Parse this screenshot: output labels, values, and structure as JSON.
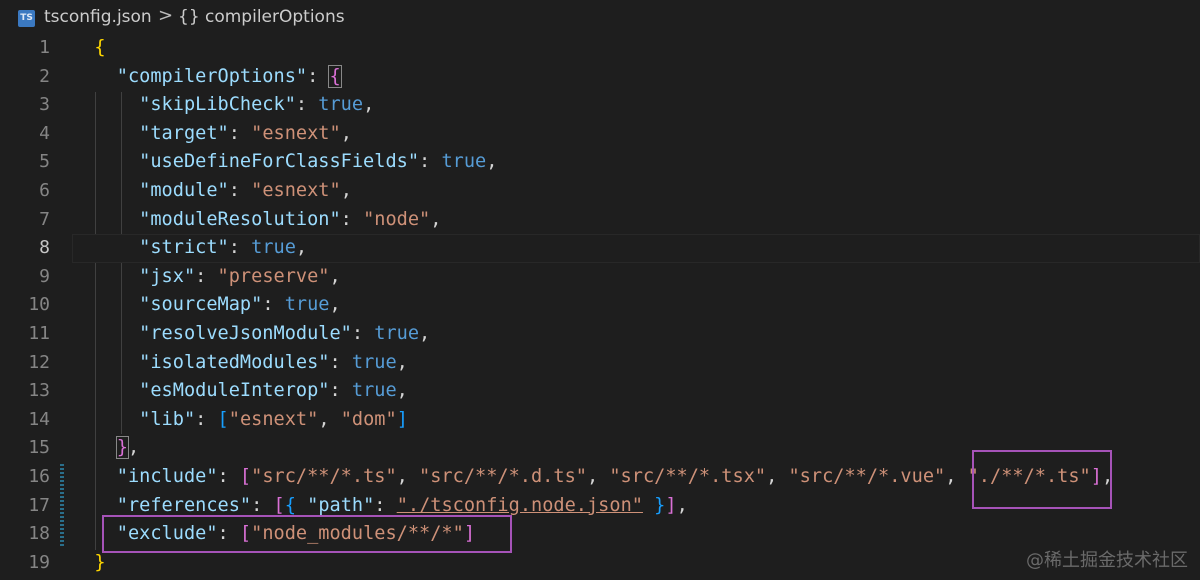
{
  "breadcrumb": {
    "file_icon": "TS",
    "file_name": "tsconfig.json",
    "separator": ">",
    "symbol_braces": "{}",
    "symbol_name": "compilerOptions"
  },
  "editor": {
    "line_numbers": [
      "1",
      "2",
      "3",
      "4",
      "5",
      "6",
      "7",
      "8",
      "9",
      "10",
      "11",
      "12",
      "13",
      "14",
      "15",
      "16",
      "17",
      "18",
      "19"
    ],
    "active_line": "8"
  },
  "watermark": "@稀土掘金技术社区",
  "colors": {
    "background": "#1e1e1e",
    "key": "#9cdcfe",
    "string": "#ce9178",
    "boolean": "#569cd6",
    "highlight_box": "#a653b8"
  }
}
